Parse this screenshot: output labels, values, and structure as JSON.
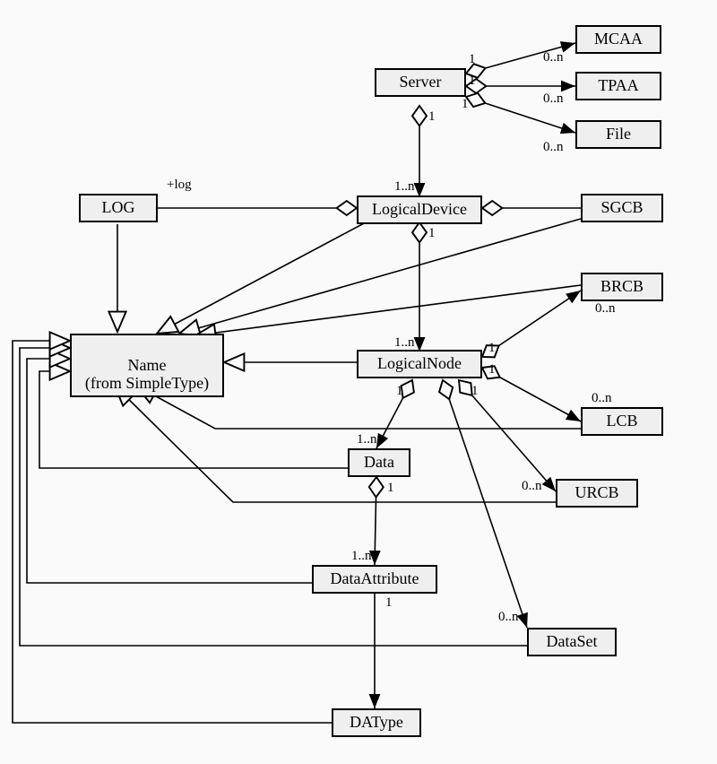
{
  "nodes": {
    "server": {
      "label": "Server"
    },
    "mcaa": {
      "label": "MCAA"
    },
    "tpaa": {
      "label": "TPAA"
    },
    "file": {
      "label": "File"
    },
    "logicalDevice": {
      "label": "LogicalDevice"
    },
    "log": {
      "label": "LOG"
    },
    "sgcb": {
      "label": "SGCB"
    },
    "logicalNode": {
      "label": "LogicalNode"
    },
    "brcb": {
      "label": "BRCB"
    },
    "lcb": {
      "label": "LCB"
    },
    "urcb": {
      "label": "URCB"
    },
    "data": {
      "label": "Data"
    },
    "dataAttribute": {
      "label": "DataAttribute"
    },
    "dataSet": {
      "label": "DataSet"
    },
    "daType": {
      "label": "DAType"
    },
    "name": {
      "label": "Name\n(from SimpleType)"
    }
  },
  "roleLabels": {
    "plusLog": "+log",
    "one": "1",
    "oneN": "1..n",
    "zeroN": "0..n"
  }
}
